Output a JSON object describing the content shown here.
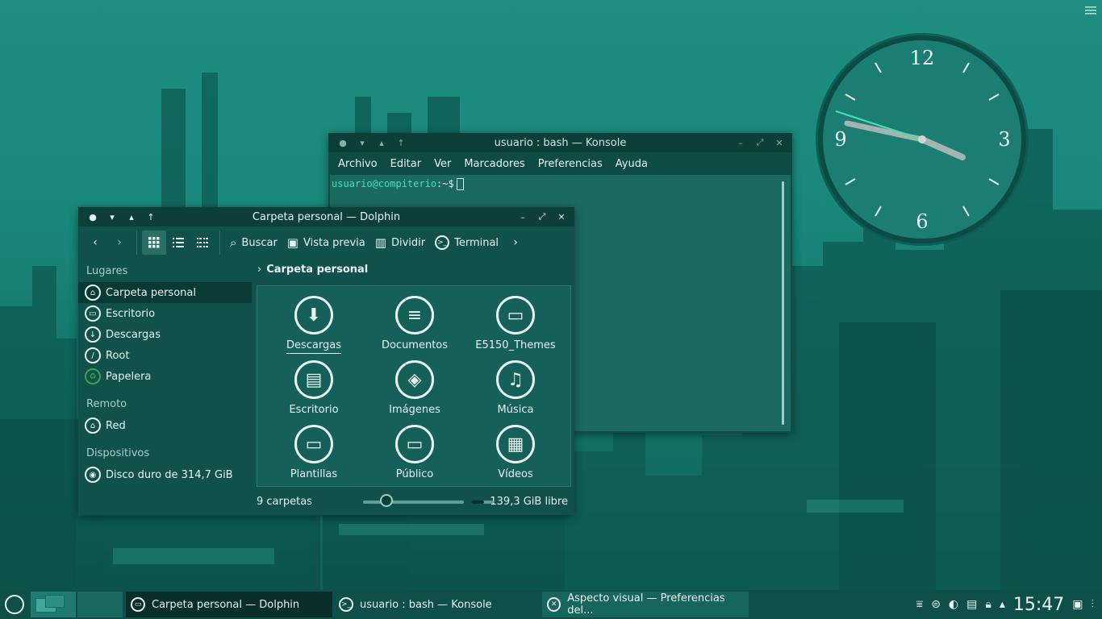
{
  "konsole": {
    "title": "usuario : bash — Konsole",
    "menus": [
      "Archivo",
      "Editar",
      "Ver",
      "Marcadores",
      "Preferencias",
      "Ayuda"
    ],
    "prompt_user": "usuario@compiterio",
    "prompt_rest": ":~$"
  },
  "dolphin": {
    "title": "Carpeta personal — Dolphin",
    "toolbar": {
      "search": "Buscar",
      "preview": "Vista previa",
      "split": "Dividir",
      "terminal": "Terminal"
    },
    "sections": {
      "places": "Lugares",
      "remote": "Remoto",
      "devices": "Dispositivos"
    },
    "places": [
      "Carpeta personal",
      "Escritorio",
      "Descargas",
      "Root",
      "Papelera"
    ],
    "remote": [
      "Red"
    ],
    "devices": [
      "Disco duro de 314,7 GiB"
    ],
    "breadcrumb": "Carpeta personal",
    "items": [
      "Descargas",
      "Documentos",
      "E5150_Themes",
      "Escritorio",
      "Imágenes",
      "Música",
      "Plantillas",
      "Público",
      "Vídeos"
    ],
    "status_count": "9 carpetas",
    "status_free": "139,3 GiB libre",
    "free_used_fraction": 0.56
  },
  "clock": {
    "n12": "12",
    "n3": "3",
    "n6": "6",
    "n9": "9"
  },
  "taskbar": {
    "tasks": [
      "Carpeta personal — Dolphin",
      "usuario : bash — Konsole",
      "Aspecto visual  — Preferencias del..."
    ],
    "time": "15:47"
  },
  "colors": {
    "accent": "#47e0b0",
    "window": "#10524b",
    "titlebar": "#0d3f3a"
  }
}
